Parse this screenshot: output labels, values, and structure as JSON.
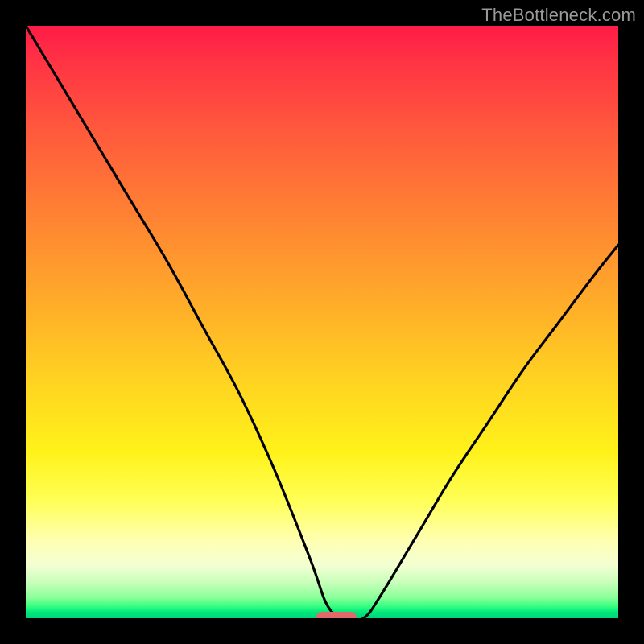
{
  "watermark": {
    "text": "TheBottleneck.com"
  },
  "colors": {
    "background": "#000000",
    "watermark_text": "#9a9a9a",
    "curve": "#000000",
    "marker": "#e06a6a"
  },
  "chart_data": {
    "type": "line",
    "title": "",
    "xlabel": "",
    "ylabel": "",
    "xlim": [
      0,
      100
    ],
    "ylim": [
      0,
      100
    ],
    "series": [
      {
        "name": "bottleneck-curve",
        "x": [
          0,
          6,
          12,
          18,
          24,
          30,
          36,
          42,
          48,
          51,
          54,
          57,
          60,
          66,
          72,
          78,
          84,
          90,
          96,
          100
        ],
        "values": [
          100,
          90,
          80,
          70,
          60,
          49,
          38,
          25,
          10,
          2,
          0,
          0,
          4,
          14,
          24,
          33,
          42,
          50,
          58,
          63
        ]
      }
    ],
    "marker": {
      "x_center": 52.5,
      "y": 0,
      "width_pct": 6.8
    }
  }
}
